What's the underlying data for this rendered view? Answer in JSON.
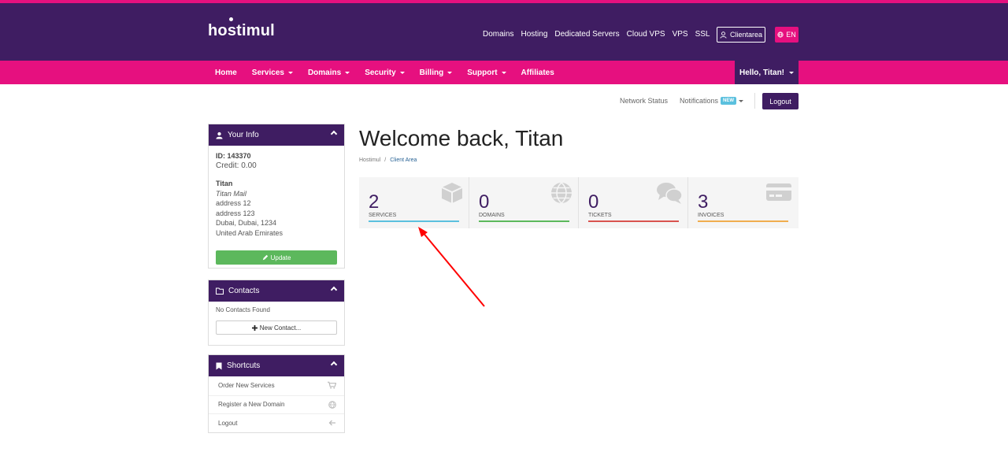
{
  "header": {
    "logo": "hostimul",
    "topnav": [
      "Domains",
      "Hosting",
      "Dedicated Servers",
      "Cloud VPS",
      "VPS",
      "SSL"
    ],
    "clientarea_label": "Clientarea",
    "lang_label": "EN"
  },
  "mainnav": {
    "items": [
      {
        "label": "Home",
        "dropdown": false
      },
      {
        "label": "Services",
        "dropdown": true
      },
      {
        "label": "Domains",
        "dropdown": true
      },
      {
        "label": "Security",
        "dropdown": true
      },
      {
        "label": "Billing",
        "dropdown": true
      },
      {
        "label": "Support",
        "dropdown": true
      },
      {
        "label": "Affiliates",
        "dropdown": false
      }
    ],
    "hello": "Hello, Titan!"
  },
  "subnav": {
    "network_status": "Network Status",
    "notifications": "Notifications",
    "new_badge": "NEW",
    "logout": "Logout"
  },
  "your_info": {
    "title": "Your Info",
    "id": "ID: 143370",
    "credit": "Credit: 0.00",
    "name": "Titan",
    "company": "Titan Mail",
    "address1": "address 12",
    "address2": "address 123",
    "city": "Dubai, Dubai, 1234",
    "country": "United Arab Emirates",
    "update_label": "Update"
  },
  "contacts": {
    "title": "Contacts",
    "empty": "No Contacts Found",
    "new_contact_label": "New Contact..."
  },
  "shortcuts": {
    "title": "Shortcuts",
    "items": [
      {
        "label": "Order New Services",
        "icon": "cart-icon"
      },
      {
        "label": "Register a New Domain",
        "icon": "globe-icon"
      },
      {
        "label": "Logout",
        "icon": "arrow-left-icon"
      }
    ]
  },
  "main": {
    "welcome": "Welcome back, Titan",
    "breadcrumb": {
      "root": "Hostimul",
      "separator": "/",
      "current": "Client Area"
    },
    "tiles": [
      {
        "count": "2",
        "label": "SERVICES",
        "color": "#5bc0de",
        "icon": "cube-icon"
      },
      {
        "count": "0",
        "label": "DOMAINS",
        "color": "#5cb85c",
        "icon": "globe-icon"
      },
      {
        "count": "0",
        "label": "TICKETS",
        "color": "#d9534f",
        "icon": "comments-icon"
      },
      {
        "count": "3",
        "label": "INVOICES",
        "color": "#f0ad4e",
        "icon": "credit-card-icon"
      }
    ]
  },
  "colors": {
    "header_purple": "#3f1d62",
    "nav_pink": "#e6107f",
    "annotation_red": "#ff0000"
  }
}
